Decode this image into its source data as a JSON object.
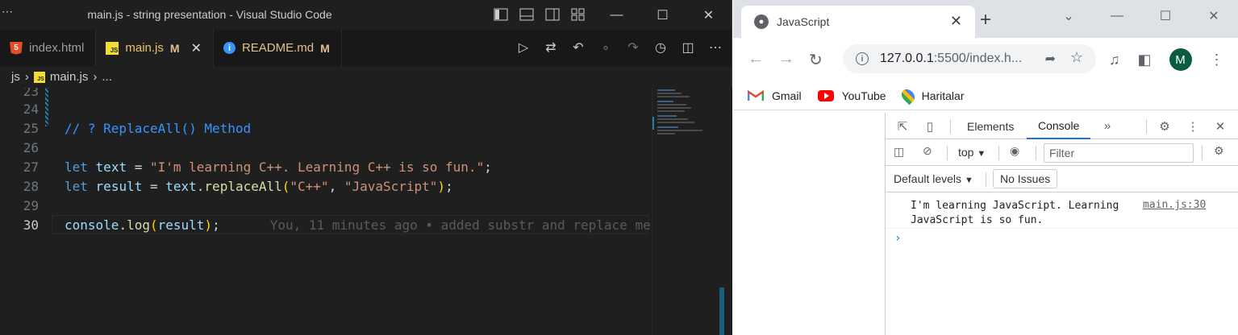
{
  "vscode": {
    "title": "main.js - string presentation - Visual Studio Code",
    "menu_dots": "⋯",
    "tabs": [
      {
        "label": "index.html",
        "icon": "html-icon",
        "modified": ""
      },
      {
        "label": "main.js",
        "icon": "js-icon",
        "modified": "M"
      },
      {
        "label": "README.md",
        "icon": "info-icon",
        "modified": "M"
      }
    ],
    "breadcrumb": {
      "folder": "js",
      "file": "main.js",
      "more": "..."
    },
    "lines": [
      {
        "num": "23"
      },
      {
        "num": "24"
      },
      {
        "num": "25",
        "comment": "// ? ReplaceAll() Method"
      },
      {
        "num": "26"
      },
      {
        "num": "27",
        "kw": "let",
        "var": "text",
        "op": " = ",
        "str": "\"I'm learning C++. Learning C++ is so fun.\"",
        "end": ";"
      },
      {
        "num": "28",
        "kw": "let",
        "var": "result",
        "op": " = ",
        "obj": "text",
        "dot": ".",
        "fn": "replaceAll",
        "open": "(",
        "arg1": "\"C++\"",
        "comma": ", ",
        "arg2": "\"JavaScript\"",
        "close": ")",
        "end": ";"
      },
      {
        "num": "29"
      },
      {
        "num": "30",
        "obj": "console",
        "dot": ".",
        "fn": "log",
        "open": "(",
        "arg": "result",
        "close": ")",
        "end": ";",
        "blame": "You, 11 minutes ago • added substr and replace me"
      }
    ]
  },
  "chrome": {
    "tab_title": "JavaScript",
    "address_host": "127.0.0.1",
    "address_path": ":5500/index.h...",
    "avatar_letter": "M",
    "bookmarks": [
      "Gmail",
      "YouTube",
      "Haritalar"
    ],
    "devtools": {
      "tabs": [
        "Elements",
        "Console"
      ],
      "active_tab": "Console",
      "context": "top",
      "filter_placeholder": "Filter",
      "levels": "Default levels",
      "issues": "No Issues",
      "log_message": "I'm learning JavaScript. Learning JavaScript is so fun.",
      "log_source": "main.js:30",
      "prompt": "›"
    }
  },
  "colors": {
    "vscode_bg": "#1e1e1e",
    "keyword": "#569cd6",
    "string": "#ce9178",
    "function": "#dcdcaa",
    "modified": "#e2c08d",
    "chrome_accent": "#1a73e8"
  }
}
